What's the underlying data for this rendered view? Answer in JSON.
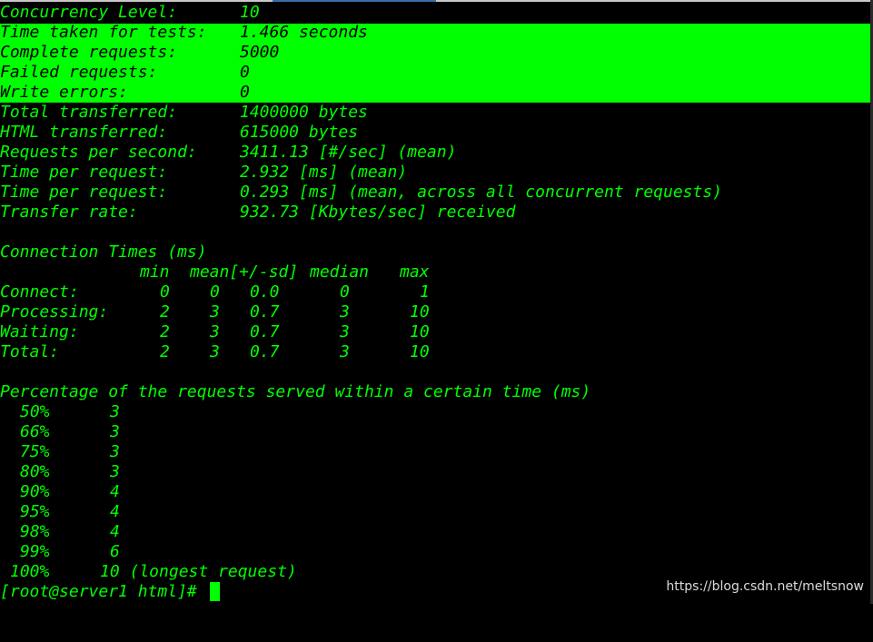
{
  "colors": {
    "background": "#000000",
    "text": "#00ff00",
    "highlight": "#00ff00",
    "highlight_text": "#000000",
    "watermark": "#ffffff"
  },
  "stats": [
    {
      "label": "Concurrency Level:",
      "value": "10"
    },
    {
      "label": "Time taken for tests:",
      "value": "1.466 seconds"
    },
    {
      "label": "Complete requests:",
      "value": "5000"
    },
    {
      "label": "Failed requests:",
      "value": "0"
    },
    {
      "label": "Write errors:",
      "value": "0"
    },
    {
      "label": "Total transferred:",
      "value": "1400000 bytes"
    },
    {
      "label": "HTML transferred:",
      "value": "615000 bytes"
    },
    {
      "label": "Requests per second:",
      "value": "3411.13 [#/sec] (mean)"
    },
    {
      "label": "Time per request:",
      "value": "2.932 [ms] (mean)"
    },
    {
      "label": "Time per request:",
      "value": "0.293 [ms] (mean, across all concurrent requests)"
    },
    {
      "label": "Transfer rate:",
      "value": "932.73 [Kbytes/sec] received"
    }
  ],
  "connection_times": {
    "title": "Connection Times (ms)",
    "header": {
      "min": "min",
      "mean": "mean[+/-sd]",
      "median": "median",
      "max": "max"
    },
    "rows": [
      {
        "label": "Connect:",
        "min": "0",
        "mean": "0",
        "sd": "0.0",
        "median": "0",
        "max": "1"
      },
      {
        "label": "Processing:",
        "min": "2",
        "mean": "3",
        "sd": "0.7",
        "median": "3",
        "max": "10"
      },
      {
        "label": "Waiting:",
        "min": "2",
        "mean": "3",
        "sd": "0.7",
        "median": "3",
        "max": "10"
      },
      {
        "label": "Total:",
        "min": "2",
        "mean": "3",
        "sd": "0.7",
        "median": "3",
        "max": "10"
      }
    ]
  },
  "percentiles": {
    "title": "Percentage of the requests served within a certain time (ms)",
    "rows": [
      {
        "pct": "50%",
        "time": "3"
      },
      {
        "pct": "66%",
        "time": "3"
      },
      {
        "pct": "75%",
        "time": "3"
      },
      {
        "pct": "80%",
        "time": "3"
      },
      {
        "pct": "90%",
        "time": "4"
      },
      {
        "pct": "95%",
        "time": "4"
      },
      {
        "pct": "98%",
        "time": "4"
      },
      {
        "pct": "99%",
        "time": "6"
      },
      {
        "pct": "100%",
        "time": "10 (longest request)"
      }
    ]
  },
  "prompt": "[root@server1 html]#",
  "watermark": "https://blog.csdn.net/meltsnow"
}
